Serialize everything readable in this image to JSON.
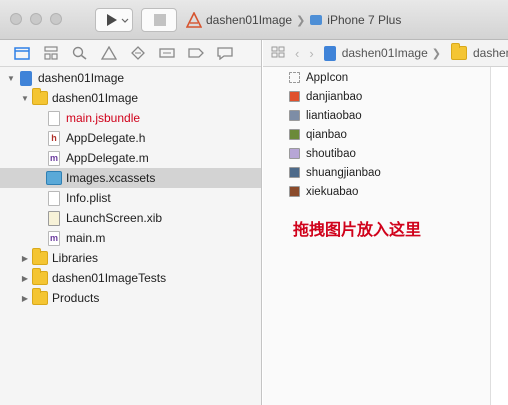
{
  "titlebar": {
    "scheme": {
      "project": "dashen01Image",
      "device": "iPhone 7 Plus"
    }
  },
  "navigator": {
    "tabs": [
      "project-navigator-icon",
      "symbol-navigator-icon",
      "find-navigator-icon",
      "issue-navigator-icon",
      "test-navigator-icon",
      "debug-navigator-icon",
      "breakpoint-navigator-icon",
      "report-navigator-icon"
    ],
    "items": [
      {
        "label": "dashen01Image",
        "kind": "project",
        "depth": 0,
        "disclosure": "open"
      },
      {
        "label": "dashen01Image",
        "kind": "folder",
        "depth": 1,
        "disclosure": "open"
      },
      {
        "label": "main.jsbundle",
        "kind": "file",
        "depth": 2,
        "color": "#d0021b"
      },
      {
        "label": "AppDelegate.h",
        "kind": "header",
        "badge": "h",
        "depth": 2
      },
      {
        "label": "AppDelegate.m",
        "kind": "source",
        "badge": "m",
        "depth": 2
      },
      {
        "label": "Images.xcassets",
        "kind": "assets",
        "depth": 2,
        "selected": true
      },
      {
        "label": "Info.plist",
        "kind": "plist",
        "depth": 2
      },
      {
        "label": "LaunchScreen.xib",
        "kind": "xib",
        "depth": 2
      },
      {
        "label": "main.m",
        "kind": "source",
        "badge": "m",
        "depth": 2
      },
      {
        "label": "Libraries",
        "kind": "folder",
        "depth": 1,
        "disclosure": "closed"
      },
      {
        "label": "dashen01ImageTests",
        "kind": "folder",
        "depth": 1,
        "disclosure": "closed"
      },
      {
        "label": "Products",
        "kind": "folder",
        "depth": 1,
        "disclosure": "closed"
      }
    ]
  },
  "jumpbar": {
    "project": "dashen01Image",
    "group": "dashen"
  },
  "assets": [
    {
      "name": "AppIcon",
      "color": "#ffffff"
    },
    {
      "name": "danjianbao",
      "color": "#e0502c"
    },
    {
      "name": "liantiaobao",
      "color": "#7d8da6"
    },
    {
      "name": "qianbao",
      "color": "#6b8a3a"
    },
    {
      "name": "shoutibao",
      "color": "#b7a6d6"
    },
    {
      "name": "shuangjianbao",
      "color": "#4d6a8a"
    },
    {
      "name": "xiekuabao",
      "color": "#8a4a2a"
    }
  ],
  "hint_text": "拖拽图片放入这里"
}
